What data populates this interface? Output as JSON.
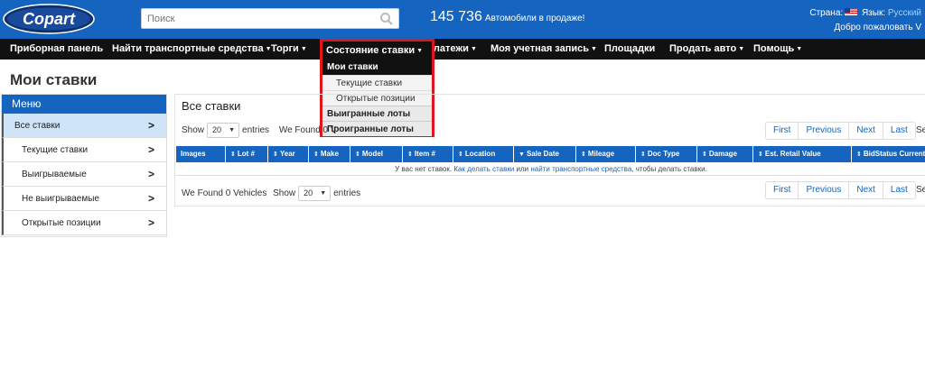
{
  "header": {
    "logo_text": "Copart",
    "search_placeholder": "Поиск",
    "count": "145 736",
    "count_text": "Автомобили в продаже!",
    "country_label": "Страна:",
    "language_label": "Язык:",
    "language_value": "Русский",
    "welcome": "Добро пожаловать V"
  },
  "nav": {
    "items": [
      {
        "label": "Приборная панель"
      },
      {
        "label": "Найти транспортные средства"
      },
      {
        "label": "Торги"
      },
      {
        "label": "Состояние ставки"
      },
      {
        "label": "Платежи"
      },
      {
        "label": "Моя учетная запись"
      },
      {
        "label": "Площадки"
      },
      {
        "label": "Продать авто"
      },
      {
        "label": "Помощь"
      }
    ]
  },
  "dropdown": {
    "title": "Состояние ставки",
    "section_header": "Мои ставки",
    "sub_items": [
      "Текущие ставки",
      "Открытые позиции"
    ],
    "main_items": [
      "Выигранные лоты",
      "Проигранные лоты"
    ]
  },
  "page_title": "Мои ставки",
  "sidebar": {
    "header": "Меню",
    "items": [
      {
        "label": "Все ставки",
        "active": true
      },
      {
        "label": "Текущие ставки"
      },
      {
        "label": "Выигрываемые"
      },
      {
        "label": "Не выигрываемые"
      },
      {
        "label": "Открытые позиции"
      }
    ]
  },
  "panel": {
    "title": "Все ставки",
    "show_label": "Show",
    "entries_label": "entries",
    "page_size": "20",
    "found_top": "We Found 0 V",
    "found_bottom": "We Found 0 Vehicles",
    "pager": [
      "First",
      "Previous",
      "Next",
      "Last"
    ],
    "search_cut": "Sea"
  },
  "table": {
    "columns": [
      "Images",
      "Lot #",
      "Year",
      "Make",
      "Model",
      "Item #",
      "Location",
      "Sale Date",
      "Mileage",
      "Doc Type",
      "Damage",
      "Est. Retail Value",
      "BidStatus",
      "CurrentBi"
    ],
    "empty_prefix": "У вас нет ставок.",
    "empty_link1": "Как делать ставки",
    "empty_mid": "или",
    "empty_link2": "найти транспортные средства",
    "empty_suffix": ", чтобы делать ставки."
  },
  "colors": {
    "brand_blue": "#1565c0",
    "nav_black": "#111111",
    "highlight_red": "#e0161a"
  }
}
